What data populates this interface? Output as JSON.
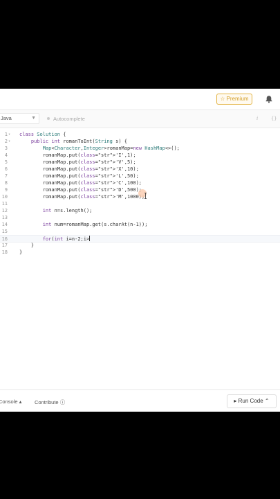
{
  "header": {
    "premium_label": "Premium"
  },
  "toolbar": {
    "language": "Java",
    "autocomplete_label": "Autocomplete"
  },
  "editor": {
    "active_line": 16,
    "lines": [
      {
        "n": "1",
        "fold": "▾",
        "text": "class Solution {"
      },
      {
        "n": "2",
        "fold": "▾",
        "text": "    public int romanToInt(String s) {"
      },
      {
        "n": "3",
        "fold": "",
        "text": "        Map<Character,Integer>romanMap=new HashMap<>();"
      },
      {
        "n": "4",
        "fold": "",
        "text": "        romanMap.put('I',1);"
      },
      {
        "n": "5",
        "fold": "",
        "text": "        romanMap.put('V',5);"
      },
      {
        "n": "6",
        "fold": "",
        "text": "        romanMap.put('X',10);"
      },
      {
        "n": "7",
        "fold": "",
        "text": "        romanMap.put('L',50);"
      },
      {
        "n": "8",
        "fold": "",
        "text": "        romanMap.put('C',100);"
      },
      {
        "n": "9",
        "fold": "",
        "text": "        romanMap.put('D',500);"
      },
      {
        "n": "10",
        "fold": "",
        "text": "        romanMap.put('M',1000);"
      },
      {
        "n": "11",
        "fold": "",
        "text": ""
      },
      {
        "n": "12",
        "fold": "",
        "text": "        int n=s.length();"
      },
      {
        "n": "13",
        "fold": "",
        "text": ""
      },
      {
        "n": "14",
        "fold": "",
        "text": "        int num=romanMap.get(s.charAt(n-1));"
      },
      {
        "n": "15",
        "fold": "",
        "text": ""
      },
      {
        "n": "16",
        "fold": "",
        "text": "        for(int i=n-2;i>"
      },
      {
        "n": "17",
        "fold": "",
        "text": "    }"
      },
      {
        "n": "18",
        "fold": "",
        "text": "}"
      }
    ]
  },
  "bottom": {
    "console_label": "Console",
    "contribute_label": "Contribute",
    "run_code_label": "Run Code"
  },
  "colors": {
    "premium": "#d4a02a",
    "keyword": "#7a3e9d",
    "string": "#a31515",
    "number": "#116644"
  }
}
